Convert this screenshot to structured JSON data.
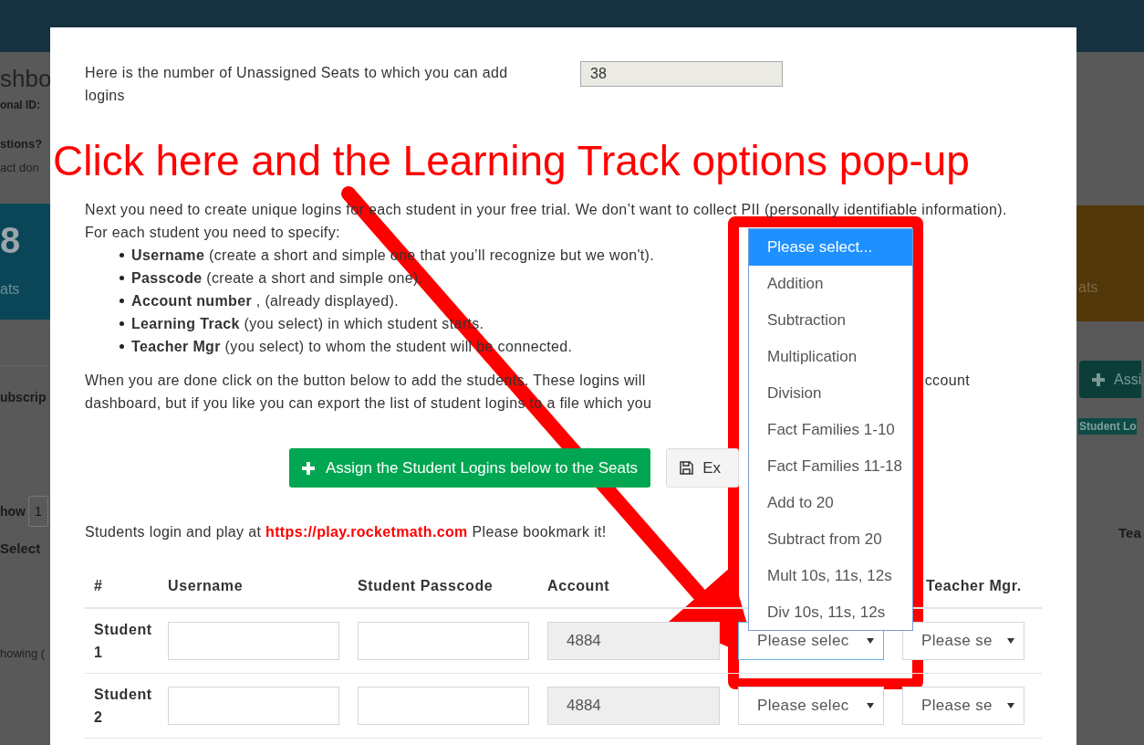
{
  "background": {
    "left": [
      {
        "kind": "title",
        "text": "shbo"
      },
      {
        "kind": "subtitle",
        "text": "onal ID:"
      },
      {
        "kind": "question",
        "text": "stions?"
      },
      {
        "kind": "note",
        "text": "act don"
      },
      {
        "kind": "stat",
        "value": "8",
        "label": "ats"
      },
      {
        "kind": "section",
        "text": "ubscrip"
      },
      {
        "kind": "show",
        "text": "how",
        "value": "1"
      },
      {
        "kind": "column",
        "text": "Select"
      },
      {
        "kind": "footer",
        "text": "howing ("
      }
    ],
    "right": [
      {
        "kind": "stat",
        "label": "ats"
      },
      {
        "kind": "button",
        "text": "Assi"
      },
      {
        "kind": "badge",
        "text": "Student Lo"
      },
      {
        "kind": "column",
        "text": "Tea"
      }
    ]
  },
  "modal": {
    "unassigned": {
      "label": "Here is the number of Unassigned Seats to which you can add logins",
      "value": "38"
    },
    "intro": [
      "Next you need to create unique logins for each student in your free trial. We don’t want to collect PII (personally identifiable information).",
      "For each student you need to specify:"
    ],
    "fields": [
      {
        "name": "Username",
        "desc": "(create a short and simple one that you’ll recognize but we won't)."
      },
      {
        "name": "Passcode",
        "desc": "(create a short and simple one)."
      },
      {
        "name": "Account number",
        "desc": ", (already displayed)."
      },
      {
        "name": "Learning Track",
        "desc": "(you select) in which student starts."
      },
      {
        "name": "Teacher Mgr",
        "desc": "(you select) to whom the student will be connected."
      }
    ],
    "done_lines": [
      "When you are done click on the button below to add the students. These logins will",
      "dashboard, but if you like you can export the list of student logins to a file which you"
    ],
    "done_tail": "ccount",
    "buttons": [
      {
        "kind": "primary",
        "text": "Assign the Student Logins below to the Seats"
      },
      {
        "kind": "secondary",
        "text": "Ex"
      }
    ],
    "login_note": {
      "text": "Students login and play at",
      "link": "https://play.rocketmath.com",
      "after": "Please bookmark it!"
    },
    "table": {
      "columns": [
        "#",
        "Username",
        "Student Passcode",
        "Account",
        "Teacher Mgr."
      ],
      "rows": [
        {
          "label": "Student 1",
          "account": "4884",
          "account_disabled": true,
          "track": "Please selec",
          "track_focused": true,
          "teacher": "Please se"
        },
        {
          "label": "Student 2",
          "account": "4884",
          "account_disabled": true,
          "track": "Please selec",
          "track_focused": false,
          "teacher": "Please se"
        }
      ]
    },
    "track_menu": {
      "options": [
        {
          "text": "Please select...",
          "selected": true
        },
        {
          "text": "Addition",
          "selected": false
        },
        {
          "text": "Subtraction",
          "selected": false
        },
        {
          "text": "Multiplication",
          "selected": false
        },
        {
          "text": "Division",
          "selected": false
        },
        {
          "text": "Fact Families 1-10",
          "selected": false
        },
        {
          "text": "Fact Families 11-18",
          "selected": false
        },
        {
          "text": "Add to 20",
          "selected": false
        },
        {
          "text": "Subtract from 20",
          "selected": false
        },
        {
          "text": "Mult 10s, 11s, 12s",
          "selected": false
        },
        {
          "text": "Div 10s, 11s, 12s",
          "selected": false
        }
      ]
    }
  },
  "annotation": {
    "callout": "Click here and the Learning Track options pop-up"
  }
}
